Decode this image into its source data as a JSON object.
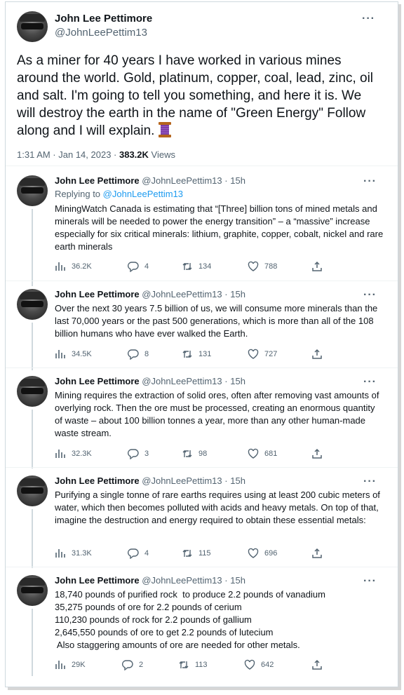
{
  "main_tweet": {
    "name": "John Lee Pettimore",
    "handle": "@JohnLeePettim13",
    "text": "As a miner for 40 years I have worked in various mines around the world. Gold, platinum, copper, coal, lead, zinc, oil and salt. I'm going to tell you something, and here it is. We will destroy the earth in the name of \"Green Energy\" Follow along and I will explain.",
    "emoji_icon": "thread-spool-icon",
    "time": "1:31 AM · Jan 14, 2023 · ",
    "views_count": "383.2K",
    "views_label": " Views"
  },
  "replies": [
    {
      "name": "John Lee Pettimore",
      "handle": "@JohnLeePettim13",
      "dot": "·",
      "time": "15h",
      "replying_prefix": "Replying to ",
      "replying_handle": "@JohnLeePettim13",
      "body": "MiningWatch Canada is estimating that “[Three] billion tons of mined metals and minerals will be needed to power the energy transition” – a “massive” increase especially for six critical minerals: lithium, graphite, copper, cobalt, nickel and rare earth minerals",
      "views": "36.2K",
      "replies": "4",
      "retweets": "134",
      "likes": "788"
    },
    {
      "name": "John Lee Pettimore",
      "handle": "@JohnLeePettim13",
      "dot": "·",
      "time": "15h",
      "body": "Over the next 30 years 7.5 billion of us, we will consume more minerals than the last 70,000 years or the past 500 generations, which is more than all of the 108 billion humans who have ever walked the Earth.",
      "views": "34.5K",
      "replies": "8",
      "retweets": "131",
      "likes": "727"
    },
    {
      "name": "John Lee Pettimore",
      "handle": "@JohnLeePettim13",
      "dot": "·",
      "time": "15h",
      "body": "Mining requires the extraction of solid ores, often after removing vast amounts of overlying rock. Then the ore must  be processed, creating an enormous quantity of waste – about 100 billion tonnes a year, more than any other human-made waste stream.",
      "views": "32.3K",
      "replies": "3",
      "retweets": "98",
      "likes": "681"
    },
    {
      "name": "John Lee Pettimore",
      "handle": "@JohnLeePettim13",
      "dot": "·",
      "time": "15h",
      "body": "Purifying a single tonne of rare earths requires using at least 200 cubic meters of water, which then becomes polluted with acids and heavy metals. On top of that, imagine the destruction and energy required to obtain these essential metals:",
      "views": "31.3K",
      "replies": "4",
      "retweets": "115",
      "likes": "696"
    },
    {
      "name": "John Lee Pettimore",
      "handle": "@JohnLeePettim13",
      "dot": "·",
      "time": "15h",
      "body_lines": [
        "18,740 pounds of purified rock  to produce 2.2 pounds of vanadium",
        "35,275 pounds of ore for 2.2 pounds of cerium",
        "110,230 pounds of rock for 2.2 pounds of gallium",
        "2,645,550 pounds of ore to get 2.2 pounds of lutecium",
        " Also staggering amounts of ore are needed for other metals."
      ],
      "views": "29K",
      "replies": "2",
      "retweets": "113",
      "likes": "642"
    }
  ],
  "more_label": "···",
  "colors": {
    "link": "#1d9bf0",
    "muted": "#536471",
    "text": "#0f1419",
    "spool": "#7b3fa6"
  }
}
